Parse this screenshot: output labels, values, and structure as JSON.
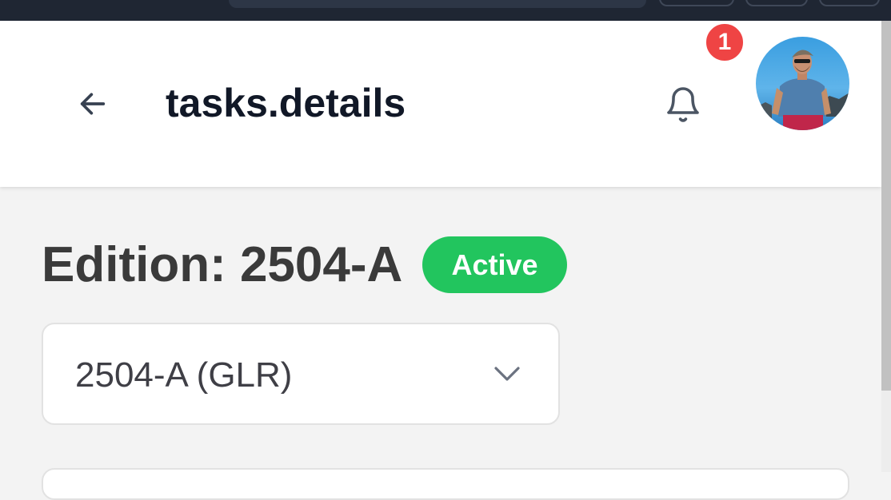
{
  "header": {
    "back_icon": "arrow-left-icon",
    "title": "tasks.details",
    "bell_icon": "bell-icon",
    "notification_count": "1",
    "avatar_icon": "user-avatar"
  },
  "edition": {
    "label": "Edition: 2504-A",
    "status": "Active",
    "status_color": "#22c55e"
  },
  "selector": {
    "selected": "2504-A (GLR)",
    "chevron_icon": "chevron-down-icon"
  },
  "colors": {
    "badge": "#ef4444",
    "title": "#111827"
  }
}
